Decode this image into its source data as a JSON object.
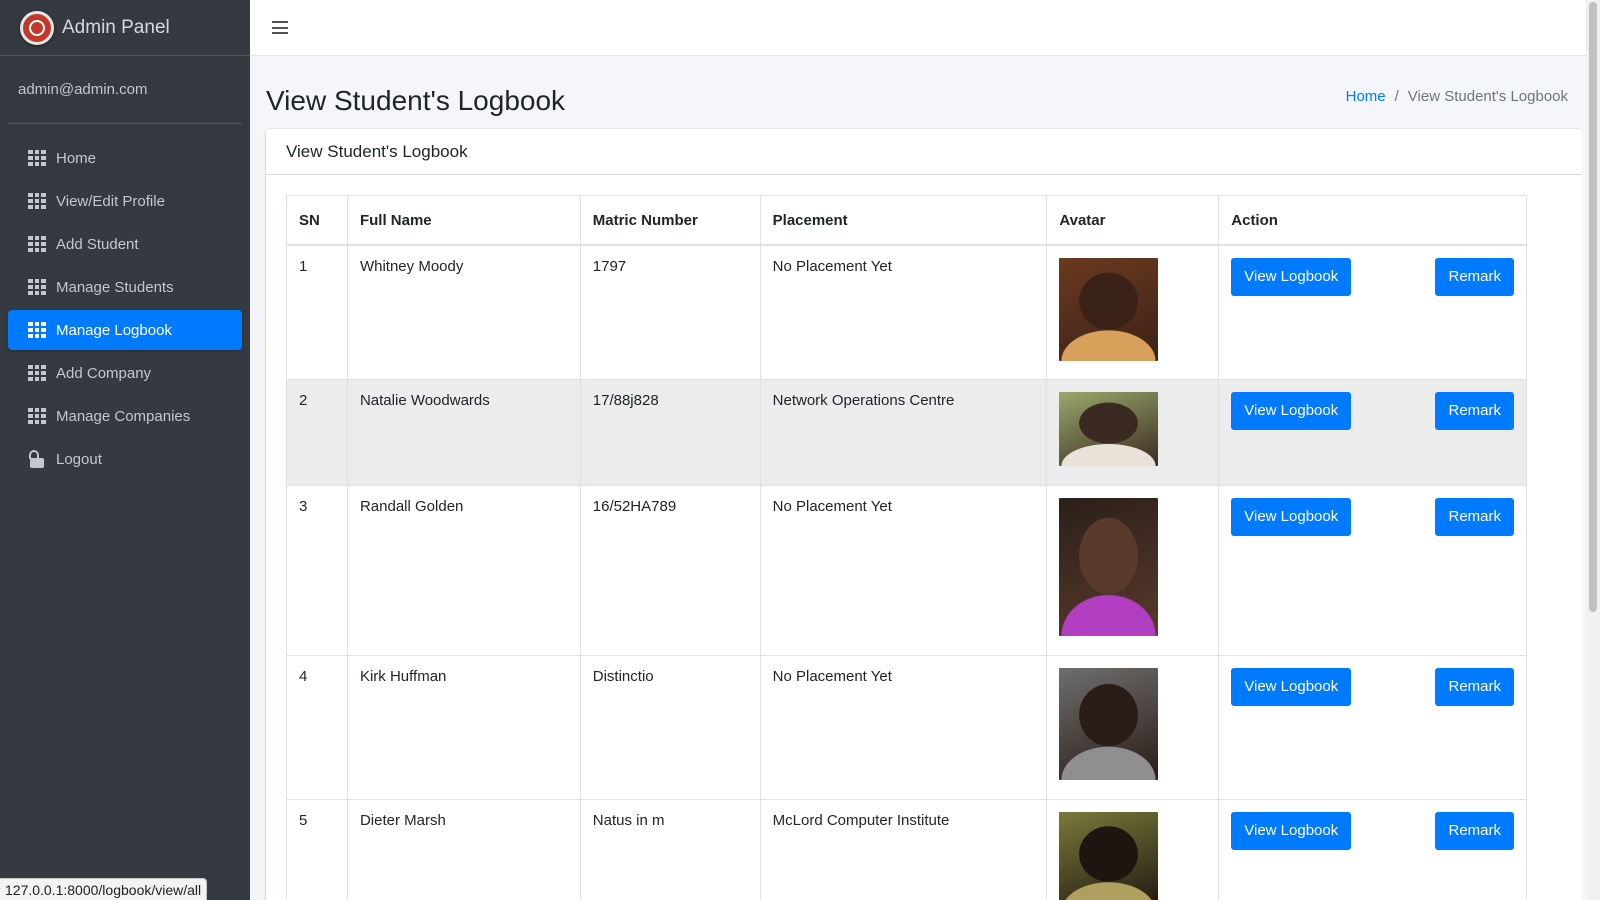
{
  "brand": {
    "title": "Admin Panel",
    "logo_icon": "crest-logo-icon"
  },
  "user": {
    "email": "admin@admin.com"
  },
  "sidebar": {
    "items": [
      {
        "label": "Home",
        "icon": "grid-icon",
        "active": false
      },
      {
        "label": "View/Edit Profile",
        "icon": "grid-icon",
        "active": false
      },
      {
        "label": "Add Student",
        "icon": "grid-icon",
        "active": false
      },
      {
        "label": "Manage Students",
        "icon": "grid-icon",
        "active": false
      },
      {
        "label": "Manage Logbook",
        "icon": "grid-icon",
        "active": true
      },
      {
        "label": "Add Company",
        "icon": "grid-icon",
        "active": false
      },
      {
        "label": "Manage Companies",
        "icon": "grid-icon",
        "active": false
      },
      {
        "label": "Logout",
        "icon": "lock-icon",
        "active": false
      }
    ]
  },
  "header": {
    "page_title": "View Student's Logbook",
    "breadcrumb": {
      "home": "Home",
      "separator": "/",
      "current": "View Student's Logbook"
    }
  },
  "card": {
    "title": "View Student's Logbook"
  },
  "table": {
    "columns": [
      "SN",
      "Full Name",
      "Matric Number",
      "Placement",
      "Avatar",
      "Action"
    ],
    "rows": [
      {
        "sn": "1",
        "name": "Whitney Moody",
        "matric": "1797",
        "placement": "No Placement Yet",
        "avatar_palette": [
          "#6b3a1f",
          "#3b2218",
          "#d9a05b"
        ]
      },
      {
        "sn": "2",
        "name": "Natalie Woodwards",
        "matric": "17/88j828",
        "placement": "Network Operations Centre",
        "avatar_palette": [
          "#9aa86b",
          "#3a2a22",
          "#e8e2d8"
        ]
      },
      {
        "sn": "3",
        "name": "Randall Golden",
        "matric": "16/52HA789",
        "placement": "No Placement Yet",
        "avatar_palette": [
          "#2b2019",
          "#5a3a2c",
          "#b23fc2"
        ]
      },
      {
        "sn": "4",
        "name": "Kirk Huffman",
        "matric": "Distinctio",
        "placement": "No Placement Yet",
        "avatar_palette": [
          "#6e6e6e",
          "#2a1c16",
          "#8f8f8f"
        ]
      },
      {
        "sn": "5",
        "name": "Dieter Marsh",
        "matric": "Natus in m",
        "placement": "McLord Computer Institute",
        "avatar_palette": [
          "#7a7a3a",
          "#1e1410",
          "#b0a060"
        ]
      }
    ],
    "actions": {
      "view": "View Logbook",
      "remark": "Remark"
    }
  },
  "status_url": "127.0.0.1:8000/logbook/view/all",
  "colors": {
    "sidebar_bg": "#343a40",
    "accent": "#007bff",
    "content_bg": "#f4f6f9"
  }
}
